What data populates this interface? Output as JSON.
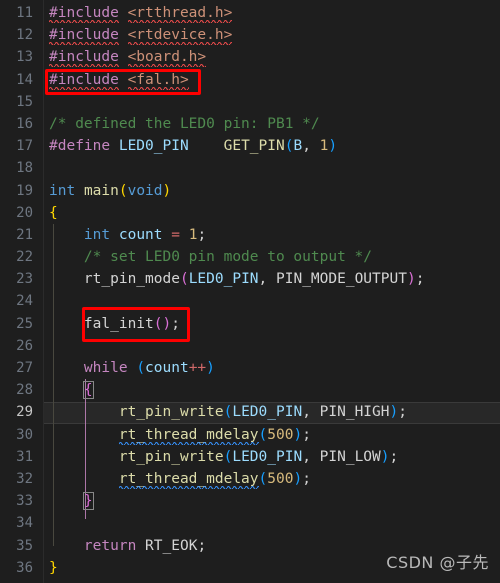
{
  "editor": {
    "language": "c",
    "background": "#1e1e1e",
    "first_line": 11,
    "last_line": 36,
    "active_line": 29,
    "annotation_color": "#fe0000"
  },
  "watermark": {
    "text": "CSDN @子先"
  },
  "line_numbers": [
    "11",
    "12",
    "13",
    "14",
    "15",
    "16",
    "17",
    "18",
    "19",
    "20",
    "21",
    "22",
    "23",
    "24",
    "25",
    "26",
    "27",
    "28",
    "29",
    "30",
    "31",
    "32",
    "33",
    "34",
    "35",
    "36"
  ],
  "code_lines": {
    "l11": {
      "directive": "#include",
      "header": "<rtthread.h>"
    },
    "l12": {
      "directive": "#include",
      "header": "<rtdevice.h>"
    },
    "l13": {
      "directive": "#include",
      "header": "<board.h>"
    },
    "l14": {
      "directive": "#include",
      "header": "<fal.h>"
    },
    "l15": {
      "text": ""
    },
    "l16": {
      "comment": "/* defined the LED0 pin: PB1 */"
    },
    "l17": {
      "directive": "#define",
      "name": "LED0_PIN",
      "spacer": "    ",
      "macro": "GET_PIN",
      "open": "(",
      "arg1": "B",
      "comma": ", ",
      "arg2": "1",
      "close": ")"
    },
    "l18": {
      "text": ""
    },
    "l19": {
      "type": "int",
      "sp": " ",
      "fn": "main",
      "open": "(",
      "arg": "void",
      "close": ")"
    },
    "l20": {
      "brace": "{"
    },
    "l21": {
      "indent": "    ",
      "type": "int",
      "sp": " ",
      "var": "count",
      "eq": " = ",
      "num": "1",
      "semi": ";"
    },
    "l22": {
      "indent": "    ",
      "comment": "/* set LED0 pin mode to output */"
    },
    "l23": {
      "indent": "    ",
      "fn": "rt_pin_mode",
      "open": "(",
      "arg1": "LED0_PIN",
      "comma": ", ",
      "arg2": "PIN_MODE_OUTPUT",
      "close": ")",
      "semi": ";"
    },
    "l24": {
      "text": ""
    },
    "l25": {
      "indent": "    ",
      "fn": "fal_init",
      "open": "(",
      "close": ")",
      "semi": ";"
    },
    "l26": {
      "text": ""
    },
    "l27": {
      "indent": "    ",
      "ctl": "while",
      "sp": " ",
      "open": "(",
      "var": "count",
      "op": "++",
      "close": ")"
    },
    "l28": {
      "indent": "    ",
      "brace": "{"
    },
    "l29": {
      "indent": "        ",
      "fn": "rt_pin_write",
      "open": "(",
      "arg1": "LED0_PIN",
      "comma": ", ",
      "arg2": "PIN_HIGH",
      "close": ")",
      "semi": ";"
    },
    "l30": {
      "indent": "        ",
      "fn": "rt_thread_mdelay",
      "open": "(",
      "arg1": "500",
      "close": ")",
      "semi": ";"
    },
    "l31": {
      "indent": "        ",
      "fn": "rt_pin_write",
      "open": "(",
      "arg1": "LED0_PIN",
      "comma": ", ",
      "arg2": "PIN_LOW",
      "close": ")",
      "semi": ";"
    },
    "l32": {
      "indent": "        ",
      "fn": "rt_thread_mdelay",
      "open": "(",
      "arg1": "500",
      "close": ")",
      "semi": ";"
    },
    "l33": {
      "indent": "    ",
      "brace": "}"
    },
    "l34": {
      "text": ""
    },
    "l35": {
      "indent": "    ",
      "ctl": "return",
      "sp": " ",
      "value": "RT_EOK",
      "semi": ";"
    },
    "l36": {
      "brace": "}"
    }
  },
  "annotations": [
    {
      "label": "include-fal-h-highlight",
      "target_line": 14
    },
    {
      "label": "fal-init-call-highlight",
      "target_line": 25
    }
  ],
  "diagnostics": {
    "red_squiggle_lines": [
      11,
      12,
      13,
      14
    ],
    "blue_squiggle_lines": [
      30,
      32
    ]
  }
}
